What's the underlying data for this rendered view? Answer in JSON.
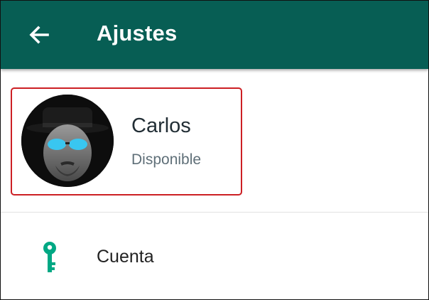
{
  "header": {
    "title": "Ajustes",
    "back_icon": "arrow-left-icon",
    "background": "#075e54"
  },
  "profile": {
    "name": "Carlos",
    "status": "Disponible",
    "highlight_color": "#cc1f24",
    "avatar": "avatar-image"
  },
  "settings": {
    "items": [
      {
        "label": "Cuenta",
        "icon": "key-icon",
        "icon_color": "#00a884"
      }
    ]
  }
}
